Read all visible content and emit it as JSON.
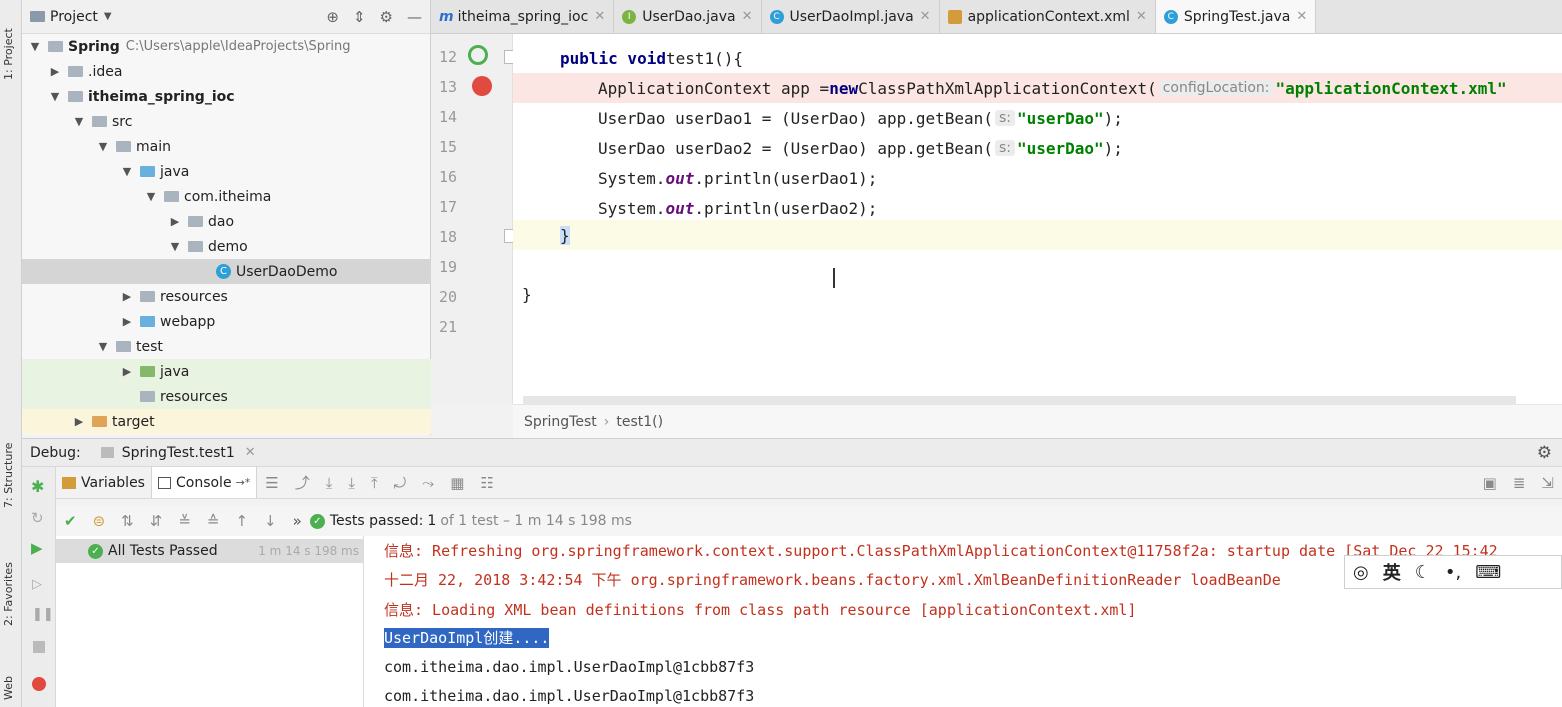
{
  "left_strip": {
    "project_tab": "1: Project",
    "structure_tab": "7: Structure",
    "favorites_tab": "2: Favorites",
    "web_tab": "Web"
  },
  "project": {
    "title": "Project",
    "tree": [
      {
        "label": "Spring",
        "path": "C:\\Users\\apple\\IdeaProjects\\Spring"
      },
      {
        "label": ".idea"
      },
      {
        "label": "itheima_spring_ioc"
      },
      {
        "label": "src"
      },
      {
        "label": "main"
      },
      {
        "label": "java"
      },
      {
        "label": "com.itheima"
      },
      {
        "label": "dao"
      },
      {
        "label": "demo"
      },
      {
        "label": "UserDaoDemo"
      },
      {
        "label": "resources"
      },
      {
        "label": "webapp"
      },
      {
        "label": "test"
      },
      {
        "label": "java"
      },
      {
        "label": "resources"
      },
      {
        "label": "target"
      }
    ]
  },
  "tabs": [
    {
      "label": "itheima_spring_ioc",
      "icon": "module-icon"
    },
    {
      "label": "UserDao.java",
      "icon": "interface-icon"
    },
    {
      "label": "UserDaoImpl.java",
      "icon": "class-icon"
    },
    {
      "label": "applicationContext.xml",
      "icon": "xml-icon"
    },
    {
      "label": "SpringTest.java",
      "icon": "class-icon"
    }
  ],
  "editor": {
    "line_numbers": [
      "12",
      "13",
      "14",
      "15",
      "16",
      "17",
      "18",
      "19",
      "20",
      "21"
    ],
    "line12": {
      "kw": "public void",
      "rest": " test1(){"
    },
    "line13": {
      "a": "ApplicationContext app = ",
      "kw": "new",
      "b": " ClassPathXmlApplicationContext(",
      "hint": "configLocation:",
      "str": "\"applicationContext.xml\""
    },
    "line14": {
      "a": "UserDao userDao1 = (UserDao) app.getBean(",
      "hint": "s:",
      "str": "\"userDao\"",
      "b": ");"
    },
    "line15": {
      "a": "UserDao userDao2 = (UserDao) app.getBean(",
      "hint": "s:",
      "str": "\"userDao\"",
      "b": ");"
    },
    "line16": {
      "a": "System.",
      "field": "out",
      "b": ".println(userDao1);"
    },
    "line17": {
      "a": "System.",
      "field": "out",
      "b": ".println(userDao2);"
    },
    "line18": "}",
    "line20": "}",
    "breadcrumb": [
      "SpringTest",
      "test1()"
    ]
  },
  "debug": {
    "label": "Debug:",
    "session": "SpringTest.test1",
    "variables_tab": "Variables",
    "console_tab": "Console",
    "tests_passed_label": "Tests passed:",
    "tests_passed_count": "1",
    "tests_passed_detail": "of 1 test – 1 m 14 s 198 ms",
    "all_tests": "All Tests Passed",
    "all_tests_time": "1 m 14 s 198 ms",
    "console_lines": [
      "信息: Refreshing org.springframework.context.support.ClassPathXmlApplicationContext@11758f2a: startup date [Sat Dec 22 15:42",
      "十二月 22, 2018 3:42:54 下午 org.springframework.beans.factory.xml.XmlBeanDefinitionReader loadBeanDe",
      "信息: Loading XML bean definitions from class path resource [applicationContext.xml]",
      "UserDaoImpl创建....",
      "com.itheima.dao.impl.UserDaoImpl@1cbb87f3",
      "com.itheima.dao.impl.UserDaoImpl@1cbb87f3"
    ]
  },
  "ime": {
    "lang": "英"
  }
}
